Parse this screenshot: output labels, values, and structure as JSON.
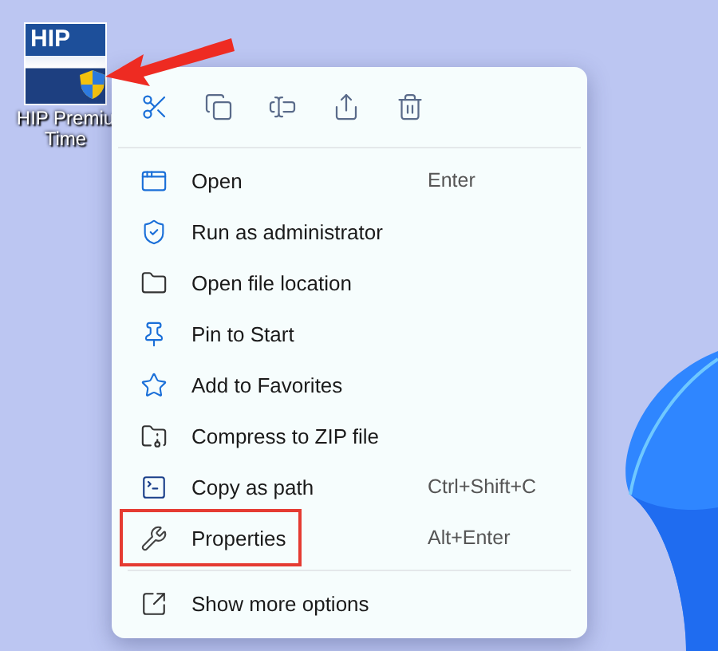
{
  "desktop_icon": {
    "logo_text": "HIP",
    "label_lines": [
      "HIP Premiu",
      "Time"
    ]
  },
  "context_menu": {
    "items": [
      {
        "label": "Open",
        "shortcut": "Enter",
        "highlighted": false
      },
      {
        "label": "Run as administrator",
        "highlighted": false
      },
      {
        "label": "Open file location",
        "highlighted": false
      },
      {
        "label": "Pin to Start",
        "highlighted": false
      },
      {
        "label": "Add to Favorites",
        "highlighted": false
      },
      {
        "label": "Compress to ZIP file",
        "highlighted": false
      },
      {
        "label": "Copy as path",
        "shortcut": "Ctrl+Shift+C",
        "highlighted": false
      },
      {
        "label": "Properties",
        "shortcut": "Alt+Enter",
        "highlighted": true
      }
    ],
    "footer": {
      "label": "Show more options"
    }
  }
}
